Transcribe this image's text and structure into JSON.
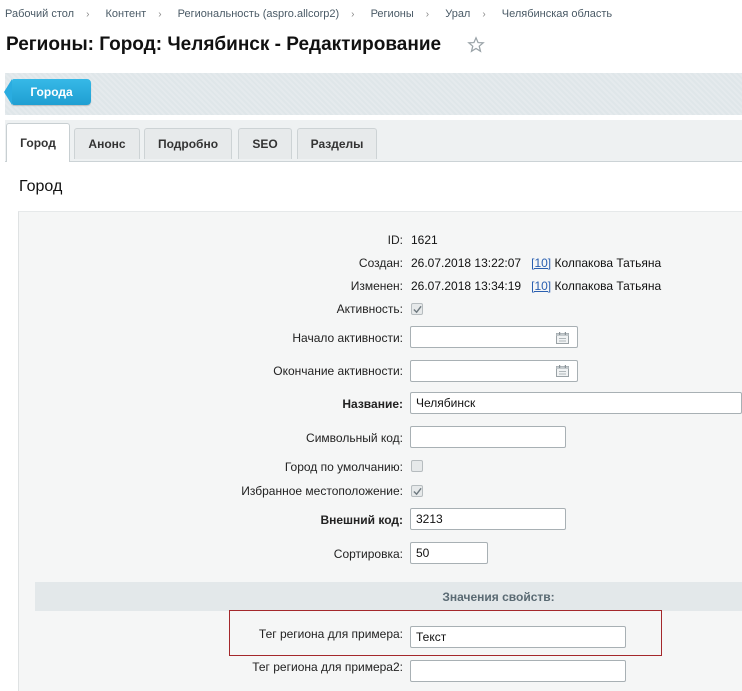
{
  "breadcrumb": [
    "Рабочий стол",
    "Контент",
    "Региональность (aspro.allcorp2)",
    "Регионы",
    "Урал",
    "Челябинская область"
  ],
  "page_title": "Регионы: Город: Челябинск - Редактирование",
  "toolbar": {
    "back_label": "Города"
  },
  "tabs": [
    "Город",
    "Анонс",
    "Подробно",
    "SEO",
    "Разделы"
  ],
  "section_title": "Город",
  "fields": {
    "id": {
      "label": "ID:",
      "value": "1621"
    },
    "created": {
      "label": "Создан:",
      "date": "26.07.2018 13:22:07",
      "user_id": "[10]",
      "user": "Колпакова Татьяна"
    },
    "modified": {
      "label": "Изменен:",
      "date": "26.07.2018 13:34:19",
      "user_id": "[10]",
      "user": "Колпакова Татьяна"
    },
    "active": {
      "label": "Активность:",
      "checked": true
    },
    "active_from": {
      "label": "Начало активности:",
      "value": ""
    },
    "active_to": {
      "label": "Окончание активности:",
      "value": ""
    },
    "name": {
      "label": "Название:",
      "value": "Челябинск"
    },
    "code": {
      "label": "Символьный код:",
      "value": ""
    },
    "default_city": {
      "label": "Город по умолчанию:",
      "checked": false
    },
    "favorite": {
      "label": "Избранное местоположение:",
      "checked": true
    },
    "external_code": {
      "label": "Внешний код:",
      "value": "3213"
    },
    "sort": {
      "label": "Сортировка:",
      "value": "50"
    }
  },
  "properties": {
    "header": "Значения свойств:",
    "region_tag": {
      "label": "Тег региона для примера:",
      "value": "Текст"
    },
    "region_tag2": {
      "label": "Тег региона для примера2:",
      "value": ""
    }
  },
  "colors": {
    "accent": "#2aace0",
    "highlight_border": "#a4282b",
    "link": "#2a5fb0"
  }
}
